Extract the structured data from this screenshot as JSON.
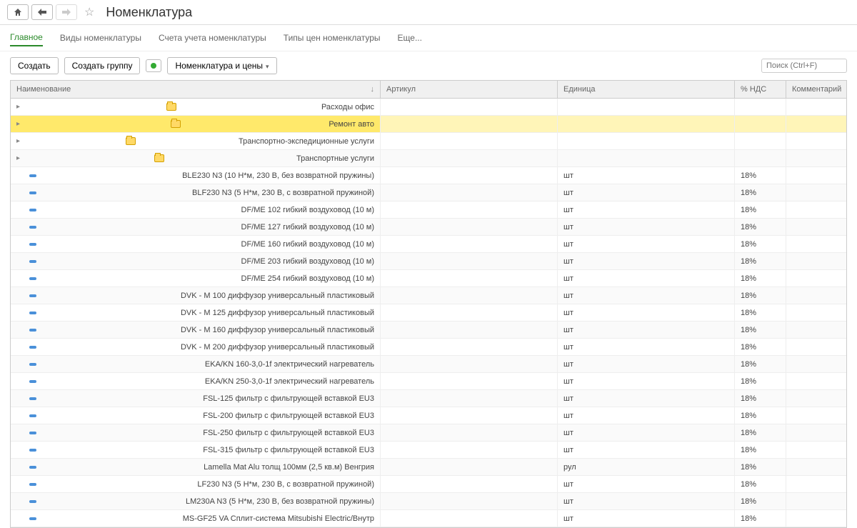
{
  "title": "Номенклатура",
  "tabs": {
    "main": "Главное",
    "types": "Виды номенклатуры",
    "accounts": "Счета учета номенклатуры",
    "price_types": "Типы цен номенклатуры",
    "more": "Еще..."
  },
  "actions": {
    "create": "Создать",
    "create_group": "Создать группу",
    "nom_prices": "Номенклатура и цены"
  },
  "search": {
    "placeholder": "Поиск (Ctrl+F)"
  },
  "columns": {
    "name": "Наименование",
    "article": "Артикул",
    "unit": "Единица",
    "vat": "% НДС",
    "comment": "Комментарий"
  },
  "rows": [
    {
      "type": "folder",
      "name": "Расходы офис",
      "article": "",
      "unit": "",
      "vat": "",
      "comment": "",
      "selected": false
    },
    {
      "type": "folder",
      "name": "Ремонт авто",
      "article": "",
      "unit": "",
      "vat": "",
      "comment": "",
      "selected": true
    },
    {
      "type": "folder",
      "name": "Транспортно-экспедиционные услуги",
      "article": "",
      "unit": "",
      "vat": "",
      "comment": "",
      "selected": false
    },
    {
      "type": "folder",
      "name": "Транспортные услуги",
      "article": "",
      "unit": "",
      "vat": "",
      "comment": "",
      "selected": false
    },
    {
      "type": "item",
      "name": "BLE230 N3 (10 Н*м, 230 В, без возвратной пружины)",
      "article": "",
      "unit": "шт",
      "vat": "18%",
      "comment": ""
    },
    {
      "type": "item",
      "name": "BLF230 N3 (5 Н*м, 230 В, с возвратной пружиной)",
      "article": "",
      "unit": "шт",
      "vat": "18%",
      "comment": ""
    },
    {
      "type": "item",
      "name": "DF/ME 102 гибкий воздуховод (10 м)",
      "article": "",
      "unit": "шт",
      "vat": "18%",
      "comment": ""
    },
    {
      "type": "item",
      "name": "DF/ME 127 гибкий воздуховод (10 м)",
      "article": "",
      "unit": "шт",
      "vat": "18%",
      "comment": ""
    },
    {
      "type": "item",
      "name": "DF/ME 160 гибкий воздуховод (10 м)",
      "article": "",
      "unit": "шт",
      "vat": "18%",
      "comment": ""
    },
    {
      "type": "item",
      "name": "DF/ME 203 гибкий воздуховод (10 м)",
      "article": "",
      "unit": "шт",
      "vat": "18%",
      "comment": ""
    },
    {
      "type": "item",
      "name": "DF/ME 254 гибкий воздуховод (10 м)",
      "article": "",
      "unit": "шт",
      "vat": "18%",
      "comment": ""
    },
    {
      "type": "item",
      "name": "DVK - M 100 диффузор универсальный пластиковый",
      "article": "",
      "unit": "шт",
      "vat": "18%",
      "comment": ""
    },
    {
      "type": "item",
      "name": "DVK - M 125 диффузор универсальный пластиковый",
      "article": "",
      "unit": "шт",
      "vat": "18%",
      "comment": ""
    },
    {
      "type": "item",
      "name": "DVK - M 160 диффузор универсальный пластиковый",
      "article": "",
      "unit": "шт",
      "vat": "18%",
      "comment": ""
    },
    {
      "type": "item",
      "name": "DVK - M 200 диффузор универсальный пластиковый",
      "article": "",
      "unit": "шт",
      "vat": "18%",
      "comment": ""
    },
    {
      "type": "item",
      "name": "EKA/KN 160-3,0-1f электрический нагреватель",
      "article": "",
      "unit": "шт",
      "vat": "18%",
      "comment": ""
    },
    {
      "type": "item",
      "name": "EKA/KN 250-3,0-1f электрический нагреватель",
      "article": "",
      "unit": "шт",
      "vat": "18%",
      "comment": ""
    },
    {
      "type": "item",
      "name": "FSL-125 фильтр с фильтрующей вставкой EU3",
      "article": "",
      "unit": "шт",
      "vat": "18%",
      "comment": ""
    },
    {
      "type": "item",
      "name": "FSL-200 фильтр с фильтрующей вставкой EU3",
      "article": "",
      "unit": "шт",
      "vat": "18%",
      "comment": ""
    },
    {
      "type": "item",
      "name": "FSL-250 фильтр с фильтрующей вставкой EU3",
      "article": "",
      "unit": "шт",
      "vat": "18%",
      "comment": ""
    },
    {
      "type": "item",
      "name": "FSL-315 фильтр с фильтрующей вставкой EU3",
      "article": "",
      "unit": "шт",
      "vat": "18%",
      "comment": ""
    },
    {
      "type": "item",
      "name": "Lamella Mat Alu толщ 100мм (2,5 кв.м) Венгрия",
      "article": "",
      "unit": "рул",
      "vat": "18%",
      "comment": ""
    },
    {
      "type": "item",
      "name": "LF230 N3 (5 Н*м, 230 В, с возвратной пружиной)",
      "article": "",
      "unit": "шт",
      "vat": "18%",
      "comment": ""
    },
    {
      "type": "item",
      "name": "LM230A N3 (5 Н*м, 230 В, без возвратной пружины)",
      "article": "",
      "unit": "шт",
      "vat": "18%",
      "comment": ""
    },
    {
      "type": "item",
      "name": "MS-GF25 VA Сплит-система Mitsubishi Electric/Внутр",
      "article": "",
      "unit": "шт",
      "vat": "18%",
      "comment": ""
    }
  ]
}
